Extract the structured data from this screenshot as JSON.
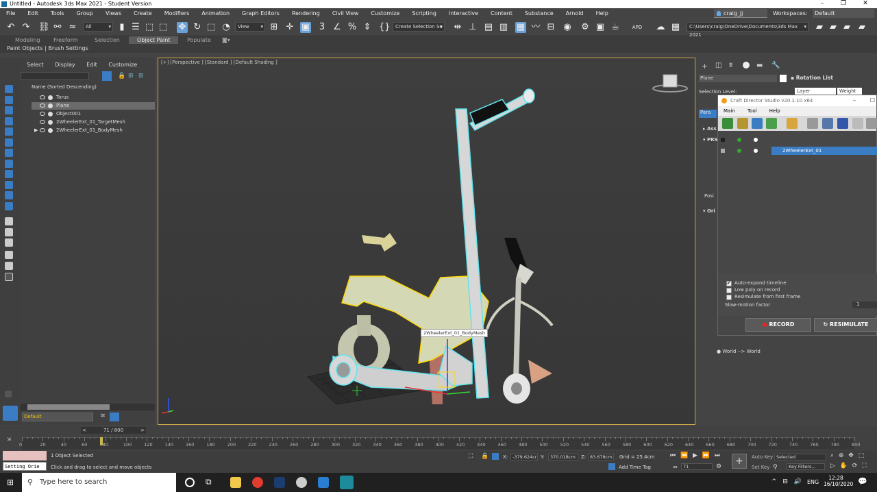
{
  "window": {
    "title": "Untitled - Autodesk 3ds Max 2021 - Student Version",
    "controls": [
      "–",
      "❐",
      "✕"
    ]
  },
  "menubar": {
    "items": [
      "File",
      "Edit",
      "Tools",
      "Group",
      "Views",
      "Create",
      "Modifiers",
      "Animation",
      "Graph Editors",
      "Rendering",
      "Civil View",
      "Customize",
      "Scripting",
      "Interactive",
      "Content",
      "Substance",
      "Arnold",
      "Help"
    ],
    "user": "craig_jj",
    "workspaces_label": "Workspaces:",
    "workspaces_value": "Default"
  },
  "toolbar": {
    "selection_filter": "All",
    "view_dropdown": "View",
    "create_selection_set": "Create Selection Se",
    "apd_label": "APD",
    "path": "C:\\Users\\craig\\OneDrive\\Documents\\3ds Max 2021"
  },
  "ribbon": {
    "tabs": [
      "Modeling",
      "Freeform",
      "Selection",
      "Object Paint",
      "Populate"
    ],
    "active_tab": "Object Paint",
    "subtabs": "Paint Objects  |  Brush Settings"
  },
  "scene_explorer": {
    "menu": [
      "Select",
      "Display",
      "Edit",
      "Customize"
    ],
    "header": "Name (Sorted Descending)",
    "items": [
      {
        "name": "Torus",
        "selected": false
      },
      {
        "name": "Plane",
        "selected": true
      },
      {
        "name": "Object001",
        "selected": false
      },
      {
        "name": "2WheelerExt_01_TargetMesh",
        "selected": false
      },
      {
        "name": "2WheelerExt_01_BodyMesh",
        "selected": false
      }
    ],
    "layer": "Default",
    "frame_counter": "71 / 800"
  },
  "viewport": {
    "label": "[+] [Perspective ] [Standard ] [Default Shading ]",
    "tooltip": "2WheelerExt_01_BodyMesh"
  },
  "command_panel": {
    "object_name": "Plane",
    "selection_level": "Selection Level:",
    "rotation_list": "Rotation List",
    "layer_col": "Layer",
    "weight_col": "Weight",
    "sections": [
      "Ass",
      "PRS",
      "Ori"
    ],
    "world": "World --> World",
    "pos_label": "Posi"
  },
  "craft_director": {
    "title": "Craft Director Studio v20.1.10 x64",
    "menu": [
      "Main",
      "Tool",
      "Help"
    ],
    "entity": "2WheelerExt_01",
    "auto_expand": "Auto-expand timeline",
    "low_poly": "Low poly on record",
    "resimulate_first": "Resimulate from first frame",
    "slow_motion": "Slow-motion factor",
    "slow_motion_value": "1",
    "record": "RECORD",
    "resimulate": "RESIMULATE"
  },
  "timeline": {
    "ticks": [
      "0",
      "20",
      "40",
      "60",
      "80",
      "100",
      "120",
      "140",
      "160",
      "180",
      "200",
      "220",
      "240",
      "260",
      "280",
      "300",
      "320",
      "340",
      "360",
      "380",
      "400",
      "420",
      "440",
      "460",
      "480",
      "500",
      "520",
      "540",
      "560",
      "580",
      "600",
      "620",
      "640",
      "660",
      "680",
      "700",
      "720",
      "740",
      "760",
      "780",
      "800"
    ]
  },
  "status": {
    "objects_selected": "1 Object Selected",
    "hint": "Click and drag to select and move objects",
    "maxscript": "Setting Orie",
    "x_label": "X:",
    "x_value": "-379.624cr",
    "y_label": "Y:",
    "y_value": "370.018cm",
    "z_label": "Z:",
    "z_value": "83.678cm",
    "grid": "Grid = 25.4cm",
    "add_time_tag": "Add Time Tag",
    "frame": "71",
    "auto_key": "Auto Key",
    "selected": "Selected",
    "set_key": "Set Key",
    "key_filters": "Key Filters..."
  },
  "taskbar": {
    "search_placeholder": "Type here to search",
    "lang": "ENG",
    "time": "12:28",
    "date": "16/10/2020"
  }
}
